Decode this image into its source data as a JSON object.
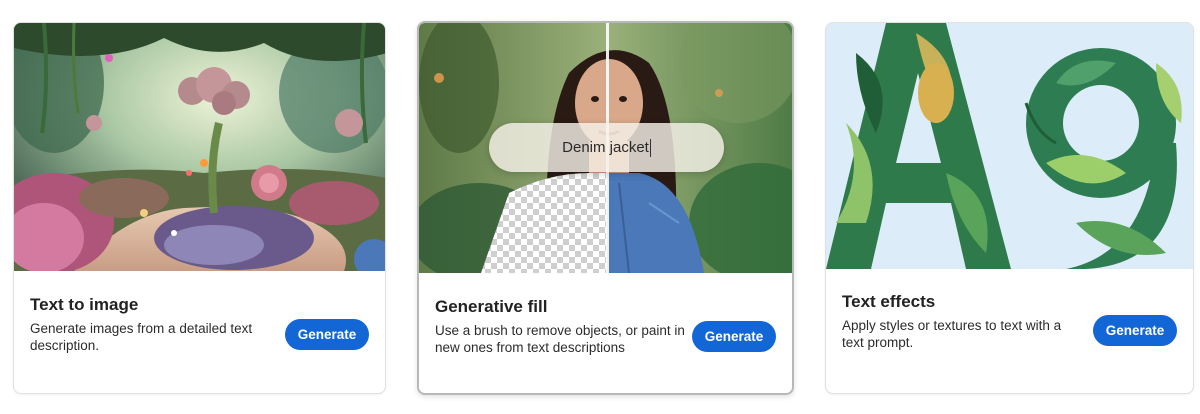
{
  "cards": [
    {
      "title": "Text to image",
      "description": "Generate images from a detailed text description.",
      "button_label": "Generate",
      "image": "fantasy-garden-illustration"
    },
    {
      "title": "Generative fill",
      "description": "Use a brush to remove objects, or paint in new ones from text descriptions",
      "button_label": "Generate",
      "image": "portrait-generative-fill-demo",
      "prompt_text": "Denim jacket"
    },
    {
      "title": "Text effects",
      "description": "Apply styles or textures to text with a text prompt.",
      "button_label": "Generate",
      "image": "leafy-letters-Ag",
      "image_text": "Ag"
    }
  ],
  "colors": {
    "button": "#1266d6",
    "card_border": "#e1e1e1",
    "text_effects_bg": "#dcecf8"
  }
}
